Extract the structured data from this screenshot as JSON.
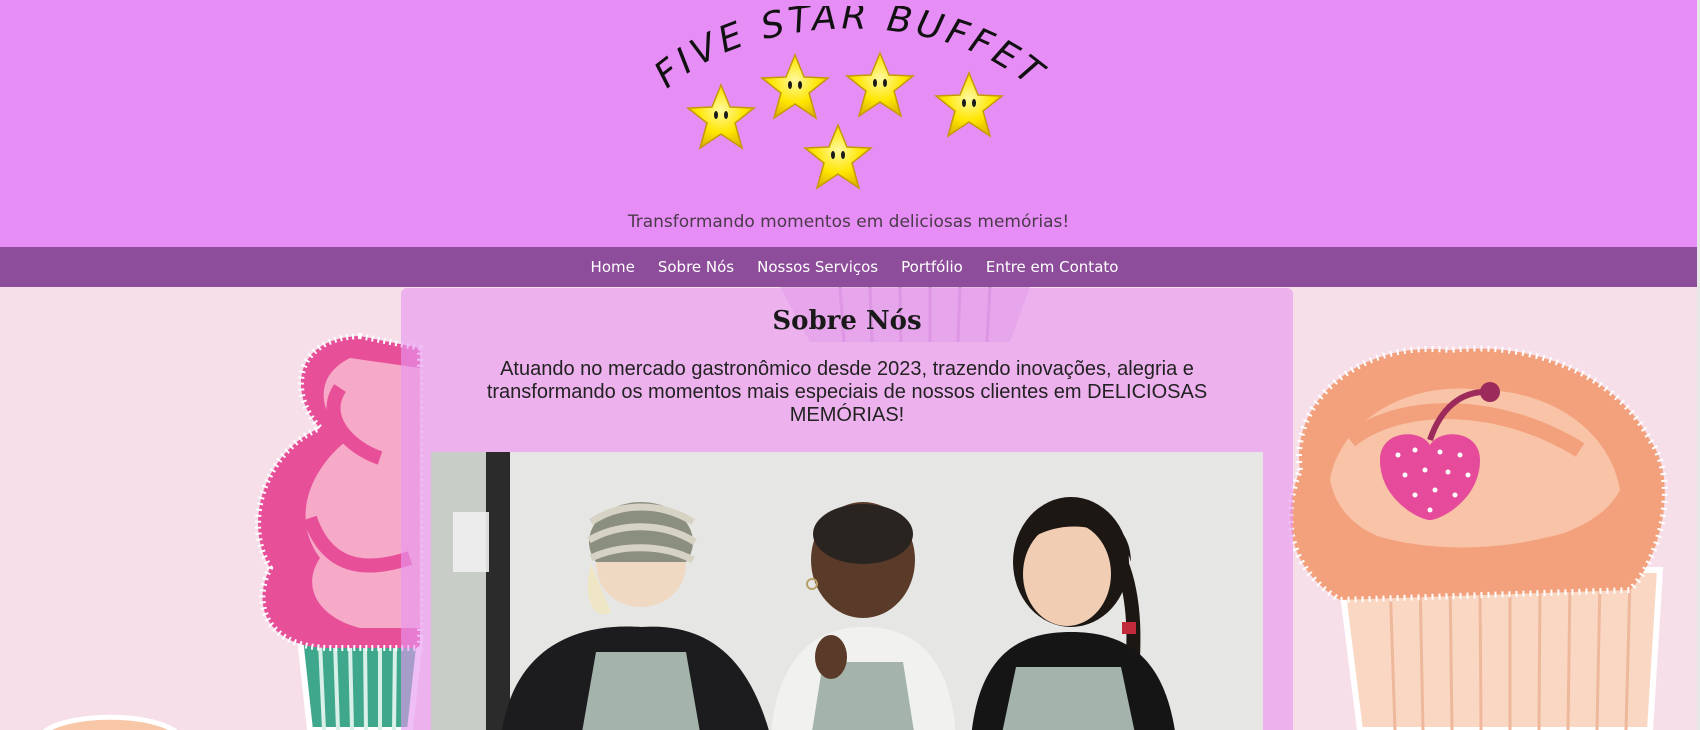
{
  "header": {
    "logo_text": "FIVE STAR BUFFET",
    "tagline": "Transformando momentos em deliciosas memórias!"
  },
  "nav": {
    "items": [
      {
        "label": "Home"
      },
      {
        "label": "Sobre Nós"
      },
      {
        "label": "Nossos Serviços"
      },
      {
        "label": "Portfólio"
      },
      {
        "label": "Entre em Contato"
      }
    ]
  },
  "about": {
    "title": "Sobre Nós",
    "text": "Atuando no mercado gastronômico desde 2023, trazendo inovações, alegria e transformando os momentos mais especiais de nossos clientes em DELICIOSAS MEMÓRIAS!"
  },
  "colors": {
    "header_bg": "#e68ef5",
    "nav_bg": "#8e4d9a",
    "page_bg": "#f7dfe9",
    "star_yellow": "#ffe600"
  },
  "icons": [
    "star-icon",
    "cupcake-illustration",
    "cherry-icon"
  ]
}
